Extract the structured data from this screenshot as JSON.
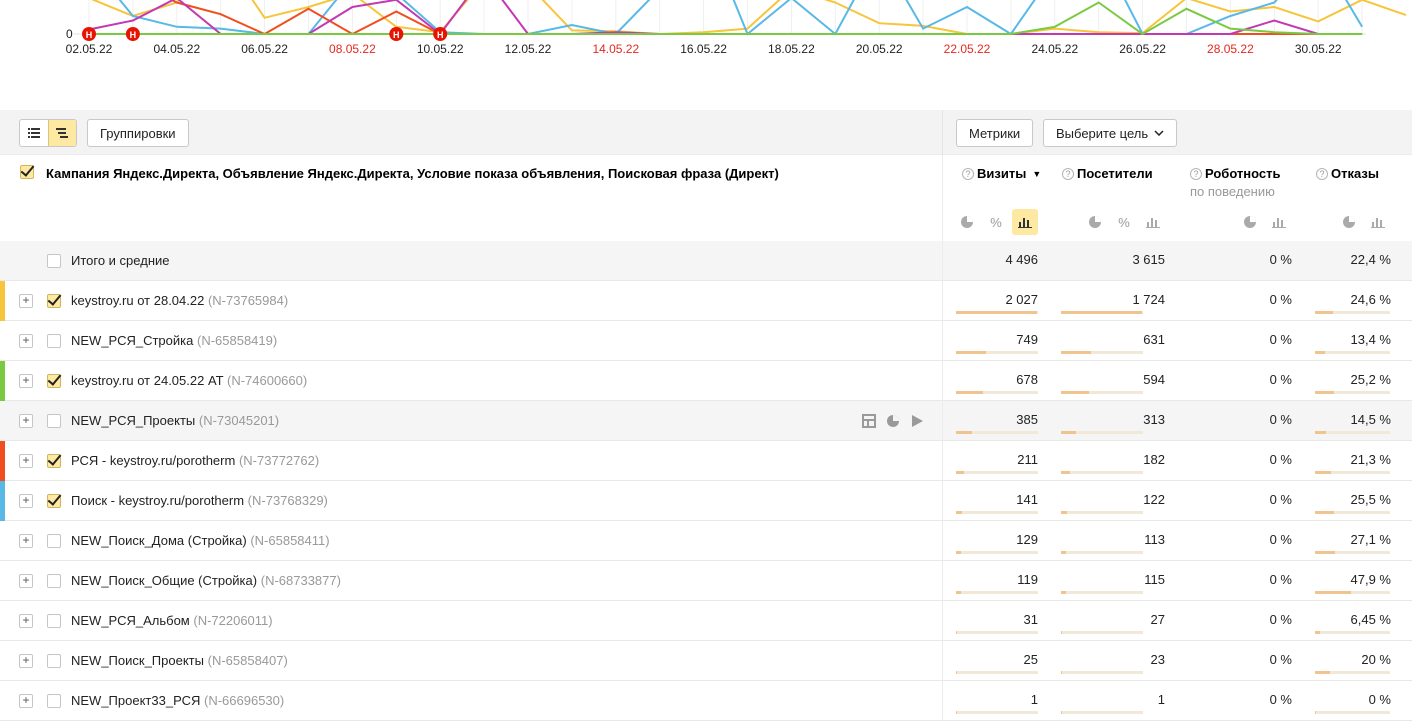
{
  "chart_data": {
    "type": "line",
    "x_tick_labels": [
      "02.05.22",
      "04.05.22",
      "06.05.22",
      "08.05.22",
      "10.05.22",
      "12.05.22",
      "14.05.22",
      "16.05.22",
      "18.05.22",
      "20.05.22",
      "22.05.22",
      "24.05.22",
      "26.05.22",
      "28.05.22",
      "30.05.22"
    ],
    "weekend_ticks": [
      "08.05.22",
      "14.05.22",
      "22.05.22",
      "28.05.22"
    ],
    "y_zero_label": "0",
    "marker_label": "H",
    "marker_dates": [
      "02.05.22",
      "03.05.22",
      "09.05.22",
      "10.05.22"
    ],
    "colors": {
      "weekend": "#e6281e",
      "marker": "#e61400"
    },
    "series": [
      {
        "color": "#f6c53b"
      },
      {
        "color": "#58b8e6"
      },
      {
        "color": "#f04e1e"
      },
      {
        "color": "#c239b3"
      },
      {
        "color": "#7ac943"
      }
    ]
  },
  "toolbar": {
    "list_view_icon": "list-icon",
    "tree_view_icon": "tree-icon",
    "groupings_label": "Группировки",
    "metrics_label": "Метрики",
    "goal_label": "Выберите цель"
  },
  "table": {
    "dimension_header": "Кампания Яндекс.Директа, Объявление Яндекс.Директа, Условие показа объявления, Поисковая фраза (Директ)",
    "columns": [
      {
        "label": "Визиты",
        "sorted": true,
        "sort_icon": "▼"
      },
      {
        "label": "Посетители"
      },
      {
        "label": "Роботность",
        "sub": "по поведению"
      },
      {
        "label": "Отказы"
      }
    ],
    "help_icon": "?",
    "expand_icon": "+",
    "total": {
      "label": "Итого и средние",
      "visits": "4 496",
      "visitors": "3 615",
      "robot": "0 %",
      "bounce": "22,4 %"
    },
    "rows": [
      {
        "name": "keystroy.ru от 28.04.22",
        "id": "(N-73765984)",
        "checked": true,
        "color": "#f6c53b",
        "visits": "2 027",
        "visitors": "1 724",
        "robot": "0 %",
        "bounce": "24,6 %",
        "visits_share": 0.45,
        "visitors_share": 0.477,
        "bounce_share": 0.246
      },
      {
        "name": "NEW_РСЯ_Стройка",
        "id": "(N-65858419)",
        "checked": false,
        "color": "",
        "visits": "749",
        "visitors": "631",
        "robot": "0 %",
        "bounce": "13,4 %",
        "visits_share": 0.167,
        "visitors_share": 0.175,
        "bounce_share": 0.134
      },
      {
        "name": "keystroy.ru от 24.05.22 AT",
        "id": "(N-74600660)",
        "checked": true,
        "color": "#7ac943",
        "visits": "678",
        "visitors": "594",
        "robot": "0 %",
        "bounce": "25,2 %",
        "visits_share": 0.151,
        "visitors_share": 0.164,
        "bounce_share": 0.252
      },
      {
        "name": "NEW_РСЯ_Проекты",
        "id": "(N-73045201)",
        "checked": false,
        "color": "",
        "visits": "385",
        "visitors": "313",
        "robot": "0 %",
        "bounce": "14,5 %",
        "visits_share": 0.086,
        "visitors_share": 0.087,
        "bounce_share": 0.145,
        "hover": true
      },
      {
        "name": "РСЯ - keystroy.ru/porotherm",
        "id": "(N-73772762)",
        "checked": true,
        "color": "#f04e1e",
        "visits": "211",
        "visitors": "182",
        "robot": "0 %",
        "bounce": "21,3 %",
        "visits_share": 0.047,
        "visitors_share": 0.05,
        "bounce_share": 0.213
      },
      {
        "name": "Поиск - keystroy.ru/porotherm",
        "id": "(N-73768329)",
        "checked": true,
        "color": "#58b8e6",
        "visits": "141",
        "visitors": "122",
        "robot": "0 %",
        "bounce": "25,5 %",
        "visits_share": 0.031,
        "visitors_share": 0.034,
        "bounce_share": 0.255
      },
      {
        "name": "NEW_Поиск_Дома (Стройка)",
        "id": "(N-65858411)",
        "checked": false,
        "color": "",
        "visits": "129",
        "visitors": "113",
        "robot": "0 %",
        "bounce": "27,1 %",
        "visits_share": 0.029,
        "visitors_share": 0.031,
        "bounce_share": 0.271
      },
      {
        "name": "NEW_Поиск_Общие (Стройка)",
        "id": "(N-68733877)",
        "checked": false,
        "color": "",
        "visits": "119",
        "visitors": "115",
        "robot": "0 %",
        "bounce": "47,9 %",
        "visits_share": 0.026,
        "visitors_share": 0.032,
        "bounce_share": 0.479
      },
      {
        "name": "NEW_РСЯ_Альбом",
        "id": "(N-72206011)",
        "checked": false,
        "color": "",
        "visits": "31",
        "visitors": "27",
        "robot": "0 %",
        "bounce": "6,45 %",
        "visits_share": 0.007,
        "visitors_share": 0.007,
        "bounce_share": 0.0645
      },
      {
        "name": "NEW_Поиск_Проекты",
        "id": "(N-65858407)",
        "checked": false,
        "color": "",
        "visits": "25",
        "visitors": "23",
        "robot": "0 %",
        "bounce": "20 %",
        "visits_share": 0.006,
        "visitors_share": 0.006,
        "bounce_share": 0.2
      },
      {
        "name": "NEW_Проект33_РСЯ",
        "id": "(N-66696530)",
        "checked": false,
        "color": "",
        "visits": "1",
        "visitors": "1",
        "robot": "0 %",
        "bounce": "0 %",
        "visits_share": 0.0002,
        "visitors_share": 0.0003,
        "bounce_share": 0
      }
    ],
    "row_tools": [
      "table-icon",
      "pie-icon",
      "play-icon"
    ]
  }
}
